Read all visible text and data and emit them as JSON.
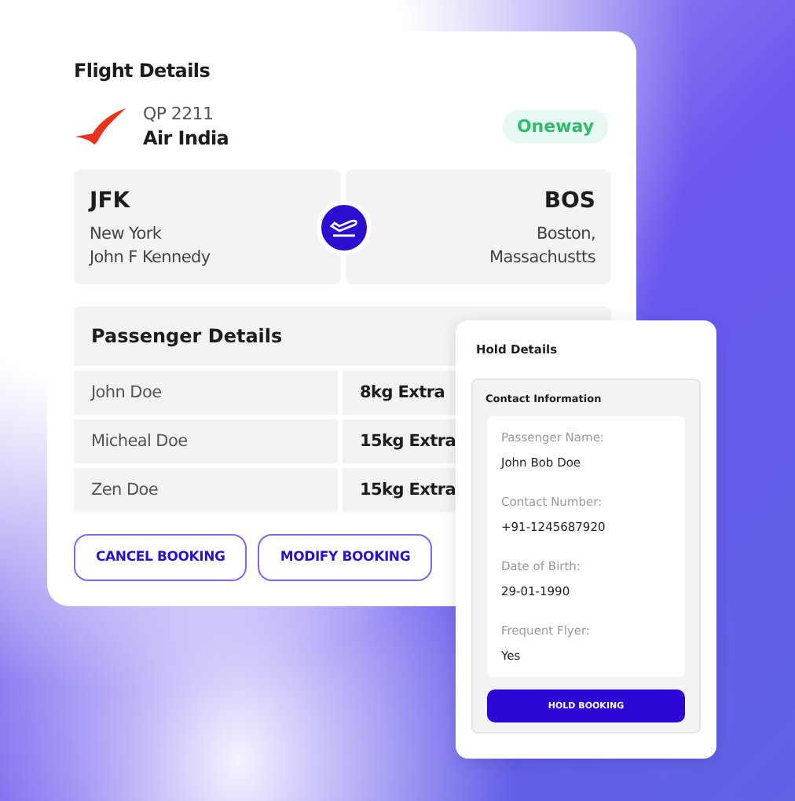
{
  "flight_card": {
    "title": "Flight Details",
    "flight_number": "QP 2211",
    "airline": "Air India",
    "trip_type": "Oneway",
    "origin": {
      "code": "JFK",
      "city": "New York",
      "airport": "John F Kennedy"
    },
    "destination": {
      "code": "BOS",
      "city": "Boston,",
      "airport": "Massachustts"
    },
    "passengers_title": "Passenger Details",
    "passengers": [
      {
        "name": "John Doe",
        "baggage": "8kg Extra"
      },
      {
        "name": "Micheal Doe",
        "baggage": "15kg Extra"
      },
      {
        "name": "Zen Doe",
        "baggage": "15kg Extra"
      }
    ],
    "buttons": [
      "CANCEL BOOKING",
      "MODIFY BOOKING"
    ]
  },
  "hold_card": {
    "title": "Hold Details",
    "section_title": "Contact Information",
    "fields": [
      {
        "label": "Passenger Name:",
        "value": "John Bob Doe"
      },
      {
        "label": "Contact Number:",
        "value": "+91-1245687920"
      },
      {
        "label": "Date of Birth:",
        "value": "29-01-1990"
      },
      {
        "label": "Frequent Flyer:",
        "value": "Yes"
      }
    ],
    "button": "HOLD BOOKING"
  }
}
